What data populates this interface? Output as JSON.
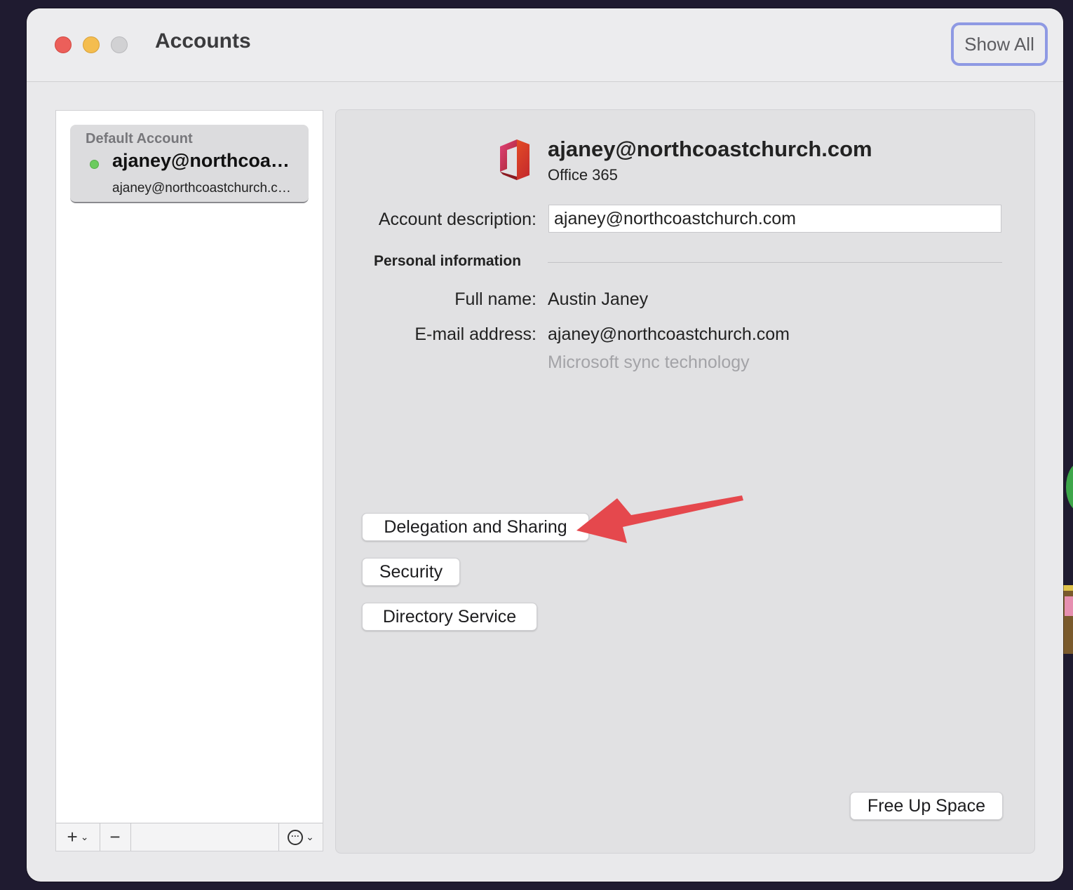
{
  "window": {
    "title": "Accounts",
    "show_all_label": "Show All"
  },
  "sidebar": {
    "accounts": [
      {
        "section_label": "Default Account",
        "name": "ajaney@northcoastchurch.com",
        "email": "ajaney@northcoastchurch.com",
        "status": "online"
      }
    ],
    "toolbar": {
      "add_label": "+",
      "remove_label": "−"
    }
  },
  "detail": {
    "header_email": "ajaney@northcoastchurch.com",
    "account_type": "Office 365",
    "description_label": "Account description:",
    "description_value": "ajaney@northcoastchurch.com",
    "personal_info_title": "Personal information",
    "full_name_label": "Full name:",
    "full_name_value": "Austin Janey",
    "email_label": "E-mail address:",
    "email_value": "ajaney@northcoastchurch.com",
    "sync_note": "Microsoft sync technology",
    "buttons": {
      "delegation": "Delegation and Sharing",
      "security": "Security",
      "directory": "Directory Service",
      "free_up_space": "Free Up Space"
    }
  },
  "colors": {
    "close": "#ec5f5a",
    "minimize": "#f4bd4f",
    "maximize": "#d1d1d3",
    "focus_ring": "#8e99e3",
    "status_online": "#6ccb5f",
    "annotation_arrow": "#e5484d"
  },
  "icons": {
    "window_controls": [
      "close-icon",
      "minimize-icon",
      "zoom-icon"
    ],
    "app_logo": "office-logo-icon",
    "toolbar": [
      "plus-icon",
      "chevron-down-icon",
      "minus-icon",
      "more-options-icon"
    ]
  }
}
